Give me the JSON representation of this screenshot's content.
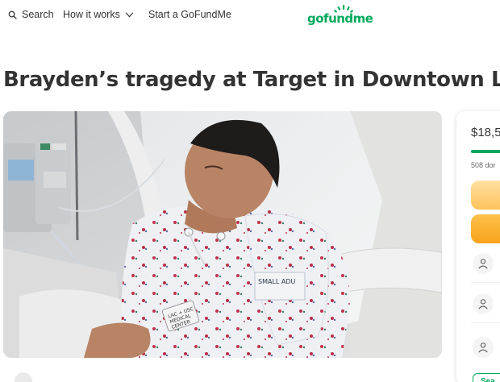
{
  "nav": {
    "search_label": "Search",
    "how_it_works_label": "How it works",
    "start_label": "Start a GoFundMe",
    "logo_text": "gofundme"
  },
  "campaign": {
    "title": "Brayden’s tragedy at Target in Downtown LA"
  },
  "hero": {
    "tag_text": "SMALL ADU",
    "wristband_line1": "LAC + USC",
    "wristband_line2": "MEDICAL",
    "wristband_line3": "CENTER"
  },
  "sidebar": {
    "amount_raised": "$18,5",
    "progress_fraction": 0.6,
    "donations_text": "508 dor",
    "see_label": "Sea"
  },
  "colors": {
    "brand_green": "#02a95c",
    "button_yellow": "#fdc35a",
    "button_orange": "#f7a31b"
  }
}
